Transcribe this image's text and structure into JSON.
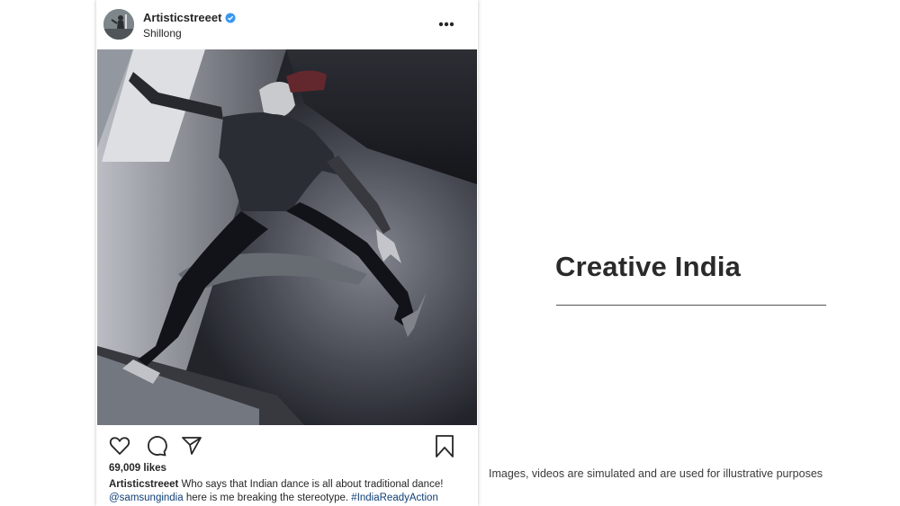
{
  "post": {
    "username": "Artisticstreeet",
    "location": "Shillong",
    "likes": "69,009 likes",
    "caption": {
      "username": "Artisticstreeet",
      "text_line1": " Who says that Indian dance is all about traditional dance!",
      "mention": "@samsungindia",
      "text_line2": " here is me breaking the stereotype. ",
      "hashtag": "#IndiaReadyAction"
    },
    "icons": {
      "verified": "verified-badge-icon",
      "more": "more-options-icon",
      "like": "heart-icon",
      "comment": "comment-bubble-icon",
      "share": "paper-plane-icon",
      "save": "bookmark-icon"
    }
  },
  "slide": {
    "title": "Creative India",
    "disclaimer": "Images, videos are simulated and are used for illustrative purposes"
  },
  "colors": {
    "text": "#262626",
    "link": "#0f3e75",
    "verified": "#3897f0",
    "title": "#2a2a2a"
  }
}
